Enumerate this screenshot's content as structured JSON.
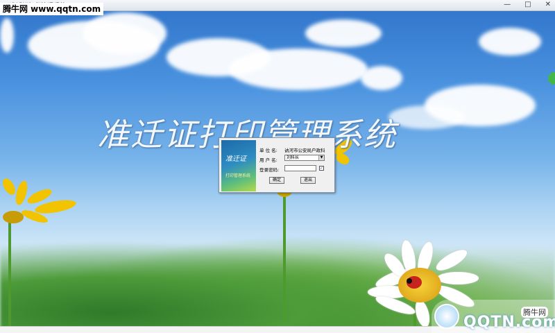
{
  "window": {
    "title": "准迁证打印管理系统",
    "controls": [
      "—",
      "□",
      "✕"
    ]
  },
  "watermark_top": "腾牛网 www.qqtn.com",
  "hero_title": "准迁证打印管理系统",
  "login": {
    "logo_text": "准迁证",
    "logo_subtext": "打印管理系统",
    "unit_label": "单 位 名:",
    "unit_value": "讷河市公安局户政科",
    "user_label": "用 户 名:",
    "user_value": "刘科长",
    "password_label": "登录密码:",
    "password_value": "",
    "remember_checked": "✓",
    "ok_button": "确定",
    "exit_button": "退出"
  },
  "watermark_br": {
    "cn": "腾牛网",
    "en": "QQTN.com"
  }
}
